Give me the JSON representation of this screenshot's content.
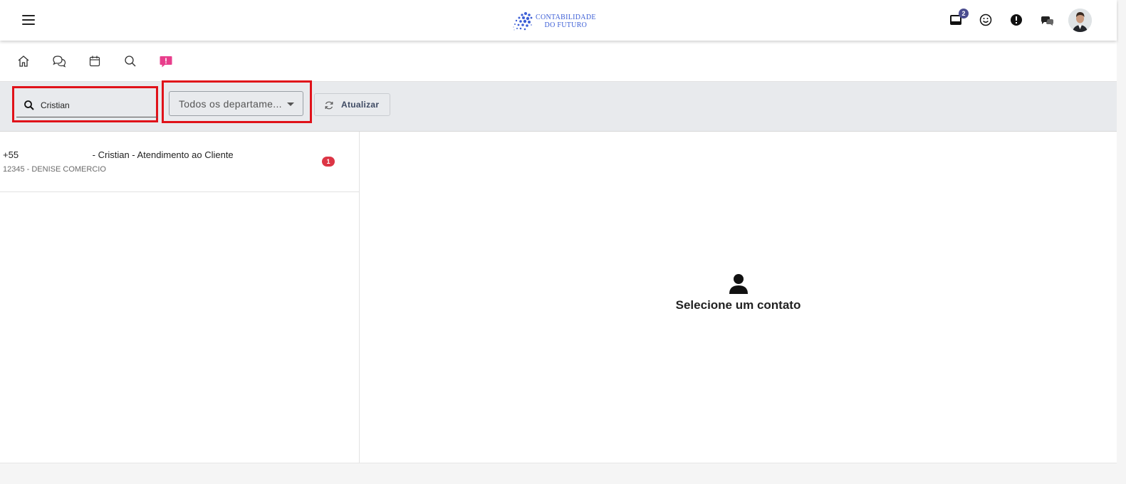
{
  "header": {
    "logo_line1": "CONTABILIDADE",
    "logo_line2": "DO FUTURO",
    "inbox_badge": "2",
    "brand_color": "#3d5fd6",
    "icons": [
      "menu-icon",
      "inbox-icon",
      "smiley-icon",
      "alert-icon",
      "chat-bubbles-icon",
      "avatar"
    ]
  },
  "toolbar": {
    "icons": [
      "home-icon",
      "conversations-icon",
      "calendar-icon",
      "search-icon",
      "alert-message-icon"
    ],
    "active_color": "#e83e8c"
  },
  "filters": {
    "search_value": "Cristian",
    "department_selected": "Todos os departame...",
    "refresh_label": "Atualizar"
  },
  "contacts": [
    {
      "phone_prefix": "+55",
      "title_rest": " - Cristian - Atendimento ao Cliente",
      "subtitle": "12345 - DENISE COMERCIO",
      "unread": "1"
    }
  ],
  "detail": {
    "empty_message": "Selecione um contato"
  }
}
